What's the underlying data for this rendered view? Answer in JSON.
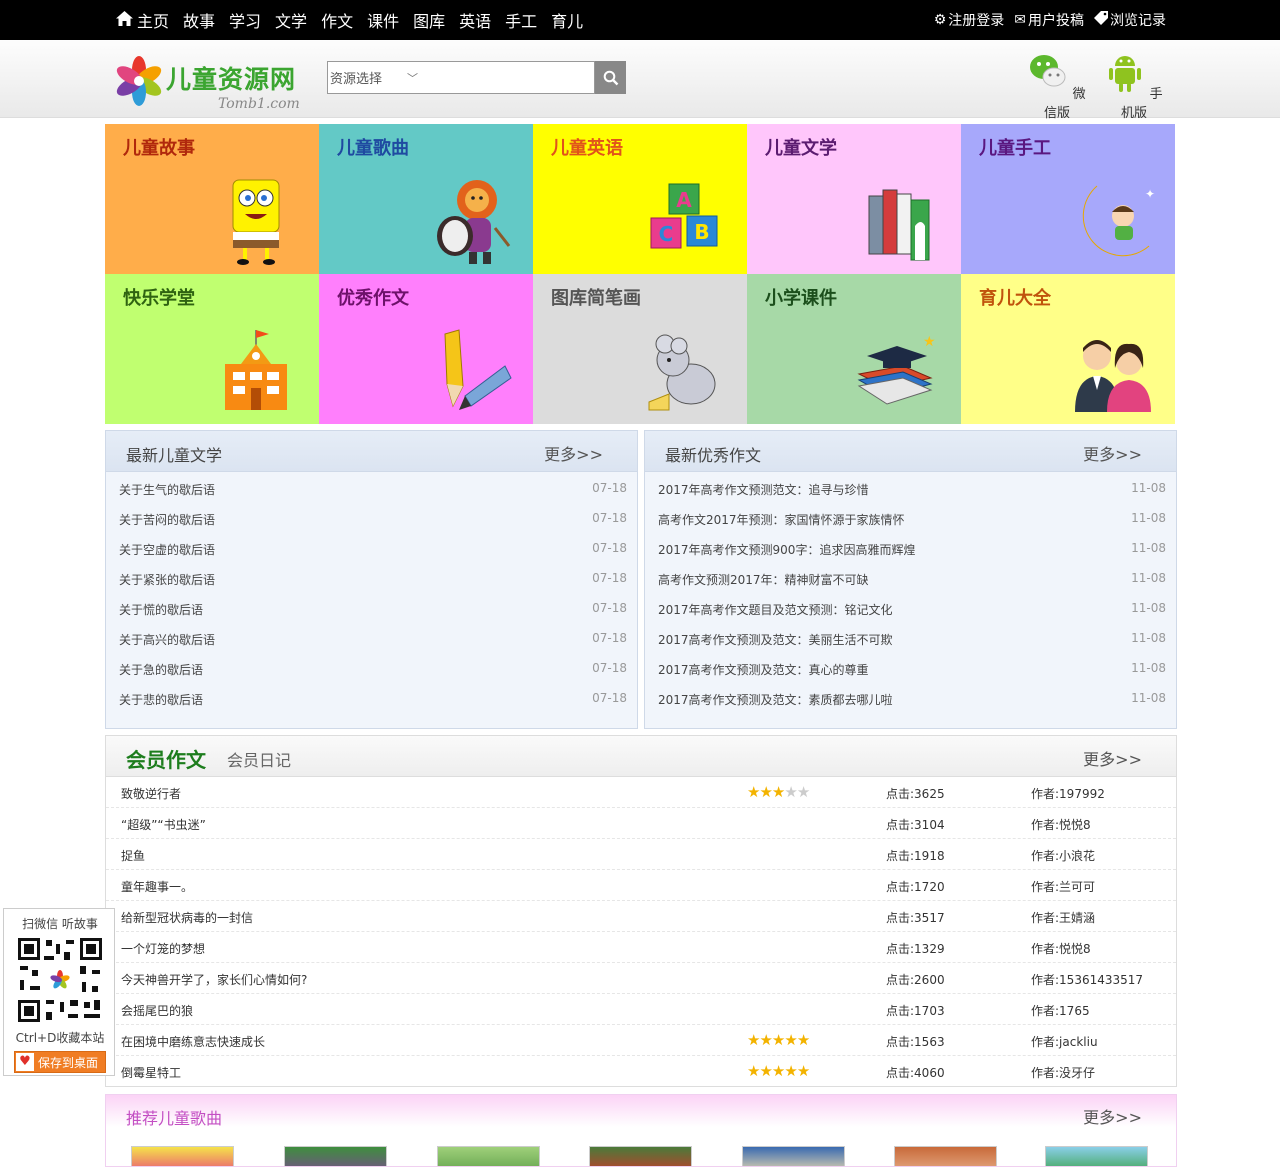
{
  "topnav": {
    "home": "主页",
    "items": [
      "故事",
      "学习",
      "文学",
      "作文",
      "课件",
      "图库",
      "英语",
      "手工",
      "育儿"
    ]
  },
  "toplinks": {
    "register": "注册登录",
    "submit": "用户投稿",
    "history": "浏览记录"
  },
  "header": {
    "logo_title": "儿童资源网",
    "logo_sub": "Tomb1.com",
    "search_select": "资源选择",
    "wechat_label": "微信版",
    "mobile_label": "手机版"
  },
  "tiles": [
    {
      "label": "儿童故事",
      "bg": "#ffad4a",
      "fg": "#b0280c",
      "icon": "spongebob-icon"
    },
    {
      "label": "儿童歌曲",
      "bg": "#63c9c6",
      "fg": "#1f4aa1",
      "icon": "lion-drum-icon"
    },
    {
      "label": "儿童英语",
      "bg": "#ffff00",
      "fg": "#e1531a",
      "icon": "abc-blocks-icon"
    },
    {
      "label": "儿童文学",
      "bg": "#ffc6fb",
      "fg": "#5b1c70",
      "icon": "books-icon"
    },
    {
      "label": "儿童手工",
      "bg": "#a7a8fb",
      "fg": "#5a1780",
      "icon": "moon-child-icon"
    },
    {
      "label": "快乐学堂",
      "bg": "#c0ff70",
      "fg": "#2f6311",
      "icon": "school-icon"
    },
    {
      "label": "优秀作文",
      "bg": "#ff7ffc",
      "fg": "#6d116a",
      "icon": "pencil-icon"
    },
    {
      "label": "图库简笔画",
      "bg": "#dcdcdc",
      "fg": "#555555",
      "icon": "mouse-icon"
    },
    {
      "label": "小学课件",
      "bg": "#a7d9a7",
      "fg": "#1c4f1c",
      "icon": "graduation-books-icon"
    },
    {
      "label": "育儿大全",
      "bg": "#ffff88",
      "fg": "#c0530c",
      "icon": "parents-icon"
    }
  ],
  "literature": {
    "title": "最新儿童文学",
    "more": "更多>>",
    "items": [
      {
        "title": "关于生气的歇后语",
        "date": "07-18"
      },
      {
        "title": "关于苦闷的歇后语",
        "date": "07-18"
      },
      {
        "title": "关于空虚的歇后语",
        "date": "07-18"
      },
      {
        "title": "关于紧张的歇后语",
        "date": "07-18"
      },
      {
        "title": "关于慌的歇后语",
        "date": "07-18"
      },
      {
        "title": "关于高兴的歇后语",
        "date": "07-18"
      },
      {
        "title": "关于急的歇后语",
        "date": "07-18"
      },
      {
        "title": "关于悲的歇后语",
        "date": "07-18"
      }
    ]
  },
  "essays": {
    "title": "最新优秀作文",
    "more": "更多>>",
    "items": [
      {
        "title": "2017年高考作文预测范文：追寻与珍惜",
        "date": "11-08"
      },
      {
        "title": "高考作文2017年预测：家国情怀源于家族情怀",
        "date": "11-08"
      },
      {
        "title": "2017年高考作文预测900字：追求因高雅而辉煌",
        "date": "11-08"
      },
      {
        "title": "高考作文预测2017年：精神财富不可缺",
        "date": "11-08"
      },
      {
        "title": "2017年高考作文题目及范文预测：铭记文化",
        "date": "11-08"
      },
      {
        "title": "2017高考作文预测及范文：美丽生活不可欺",
        "date": "11-08"
      },
      {
        "title": "2017高考作文预测及范文：真心的尊重",
        "date": "11-08"
      },
      {
        "title": "2017高考作文预测及范文：素质都去哪儿啦",
        "date": "11-08"
      }
    ]
  },
  "member": {
    "title": "会员作文",
    "tab2": "会员日记",
    "more": "更多>>",
    "rows": [
      {
        "title": "致敬逆行者",
        "stars": 3,
        "clicks": "点击:3625",
        "author": "作者:197992"
      },
      {
        "title": "“超级”“书虫迷”",
        "stars": 0,
        "clicks": "点击:3104",
        "author": "作者:悦悦8"
      },
      {
        "title": "捉鱼",
        "stars": 0,
        "clicks": "点击:1918",
        "author": "作者:小浪花"
      },
      {
        "title": "童年趣事一。",
        "stars": 0,
        "clicks": "点击:1720",
        "author": "作者:兰可可"
      },
      {
        "title": "给新型冠状病毒的一封信",
        "stars": 0,
        "clicks": "点击:3517",
        "author": "作者:王婧涵"
      },
      {
        "title": "一个灯笼的梦想",
        "stars": 0,
        "clicks": "点击:1329",
        "author": "作者:悦悦8"
      },
      {
        "title": "今天神兽开学了，家长们心情如何?",
        "stars": 0,
        "clicks": "点击:2600",
        "author": "作者:15361433517"
      },
      {
        "title": "会摇尾巴的狼",
        "stars": 0,
        "clicks": "点击:1703",
        "author": "作者:1765"
      },
      {
        "title": "在困境中磨练意志快速成长",
        "stars": 5,
        "clicks": "点击:1563",
        "author": "作者:jackliu"
      },
      {
        "title": "倒霉星特工",
        "stars": 5,
        "clicks": "点击:4060",
        "author": "作者:没牙仔"
      }
    ]
  },
  "songs": {
    "title": "推荐儿童歌曲",
    "more": "更多>>"
  },
  "qr": {
    "top": "扫微信 听故事",
    "ctrl": "Ctrl+D收藏本站",
    "save": "保存到桌面"
  }
}
